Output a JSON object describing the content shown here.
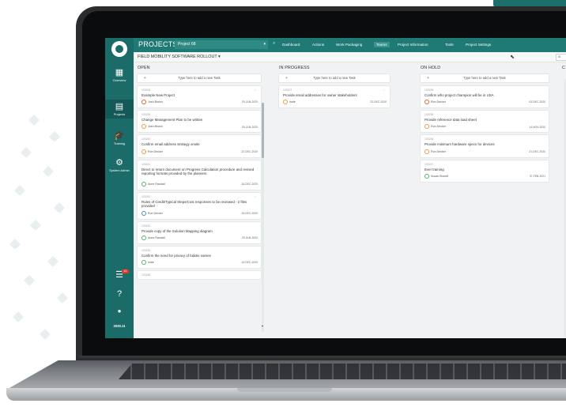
{
  "app": {
    "section_title": "PROJECTS",
    "project_selector": "Project 68",
    "breadcrumb": "FIELD MOBILITY SOFTWARE ROLLOUT",
    "breadcrumb_caret": "▾",
    "version": "2020.11",
    "notification_count": "12",
    "accent": "#1f7a75"
  },
  "sidebar": {
    "items": [
      {
        "label": "Overview",
        "icon": "grid-icon",
        "glyph": "▦"
      },
      {
        "label": "Projects",
        "icon": "projects-icon",
        "glyph": "▤"
      },
      {
        "label": "Training",
        "icon": "graduation-cap-icon",
        "glyph": "🎓"
      },
      {
        "label": "System Admin",
        "icon": "gear-icon",
        "glyph": "⚙"
      }
    ],
    "bottom": [
      {
        "icon": "notifications-icon",
        "glyph": "☰"
      },
      {
        "icon": "help-icon",
        "glyph": "?"
      },
      {
        "icon": "user-icon",
        "glyph": "●"
      }
    ]
  },
  "topnav": [
    "Dashboard",
    "Actions",
    "Work Packaging",
    "Teams",
    "Project Information",
    "Tools",
    "Project Settings"
  ],
  "topnav_active": "Teams",
  "columns": [
    {
      "title": "OPEN",
      "add_placeholder": "Type here to add a new Task",
      "cards": [
        {
          "id": "103234",
          "title": "Example New Project",
          "owner": "Josh Brown",
          "date": "29-JUN-2020",
          "avatar": "red",
          "msg": true
        },
        {
          "id": "103239",
          "title": "Change Management Plan to be written",
          "owner": "Josh Brown",
          "date": "29-JUN-2020",
          "avatar": "orange",
          "msg": false
        },
        {
          "id": "103240",
          "title": "Confirm email address strategy onsite",
          "owner": "Ron Decker",
          "date": "22-DEC-2020",
          "avatar": "orange",
          "msg": false
        },
        {
          "id": "103241",
          "title": "Direct to return document on Progress Calculation procedure and revised reporting formats provided by the planners",
          "owner": "Anne Randall",
          "date": "15-DEC-2020",
          "avatar": "green",
          "msg": false
        },
        {
          "id": "103242",
          "title": "Rules of Credit/Typical Steps/Cost responses to be reviewed - 2 files provided",
          "owner": "Ron Decker",
          "date": "15-DEC-2020",
          "avatar": "blue",
          "msg": true
        },
        {
          "id": "103243",
          "title": "Provide copy of the Solution Mapping diagram",
          "owner": "Anne Randall",
          "date": "29-JUN-2020",
          "avatar": "green",
          "msg": false
        },
        {
          "id": "103244",
          "title": "Confirm the need for privacy of bidder names",
          "owner": "Indie",
          "date": "14-DEC-2020",
          "avatar": "green",
          "msg": false
        },
        {
          "id": "103245",
          "title": "",
          "owner": "",
          "date": "",
          "avatar": "",
          "msg": false
        }
      ]
    },
    {
      "title": "IN PROGRESS",
      "add_placeholder": "Type here to add a new Task",
      "cards": [
        {
          "id": "103237",
          "title": "Provide email addresses for owner stakeholders",
          "owner": "Indie",
          "date": "22-DEC-2020",
          "avatar": "orange",
          "msg": true
        }
      ]
    },
    {
      "title": "ON HOLD",
      "add_placeholder": "Type here to add a new Task",
      "cards": [
        {
          "id": "103235",
          "title": "Confirm who project champion will be in USA",
          "owner": "Ron Decker",
          "date": "03-DEC-2020",
          "avatar": "red",
          "msg": false
        },
        {
          "id": "103238",
          "title": "Provide reference data load sheet",
          "owner": "Ron Decker",
          "date": "14-NOV-2020",
          "avatar": "orange",
          "msg": false
        },
        {
          "id": "103236",
          "title": "Provide minimum hardware specs for devices",
          "owner": "Ron Decker",
          "date": "21-DEC-2020",
          "avatar": "orange",
          "msg": false
        },
        {
          "id": "103247",
          "title": "Ever training",
          "owner": "Susan Brandt",
          "date": "07-FEB-2021",
          "avatar": "green",
          "msg": false
        }
      ]
    },
    {
      "title": "C",
      "add_placeholder": "",
      "cards": []
    }
  ]
}
